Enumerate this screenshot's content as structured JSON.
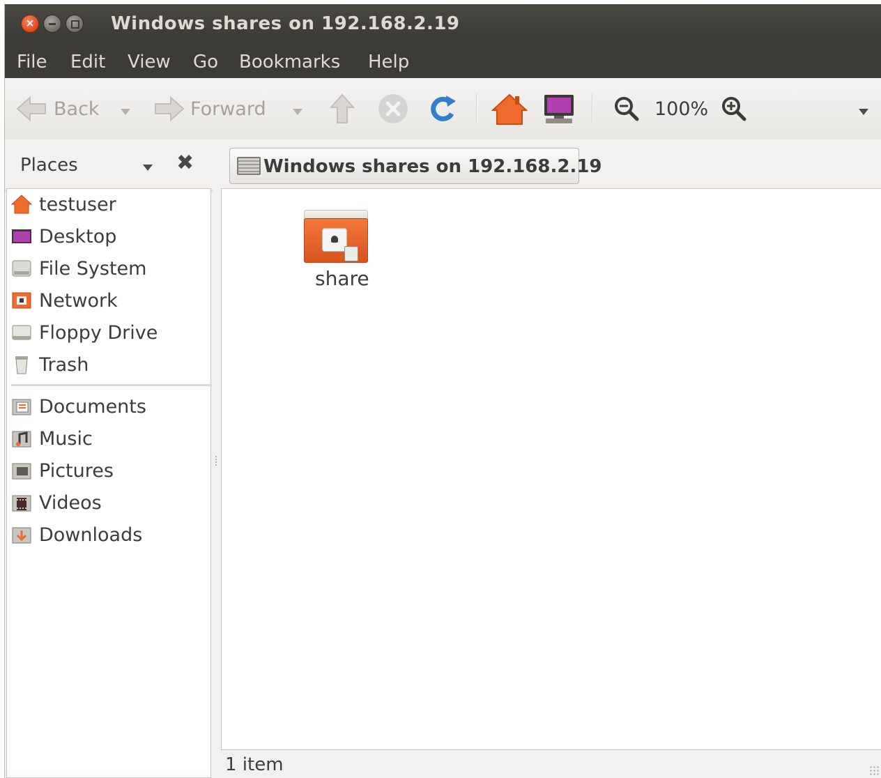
{
  "window": {
    "title": "Windows shares on 192.168.2.19"
  },
  "menubar": {
    "items": [
      "File",
      "Edit",
      "View",
      "Go",
      "Bookmarks",
      "Help"
    ]
  },
  "toolbar": {
    "back_label": "Back",
    "forward_label": "Forward",
    "zoom_level": "100%"
  },
  "places": {
    "header_label": "Places",
    "items": [
      {
        "label": "testuser",
        "icon": "home-icon"
      },
      {
        "label": "Desktop",
        "icon": "desktop-icon"
      },
      {
        "label": "File System",
        "icon": "harddisk-icon"
      },
      {
        "label": "Network",
        "icon": "network-icon"
      },
      {
        "label": "Floppy Drive",
        "icon": "floppy-icon"
      },
      {
        "label": "Trash",
        "icon": "trash-icon"
      }
    ],
    "bookmarks": [
      {
        "label": "Documents",
        "icon": "documents-folder-icon"
      },
      {
        "label": "Music",
        "icon": "music-folder-icon"
      },
      {
        "label": "Pictures",
        "icon": "pictures-folder-icon"
      },
      {
        "label": "Videos",
        "icon": "videos-folder-icon"
      },
      {
        "label": "Downloads",
        "icon": "downloads-folder-icon"
      }
    ]
  },
  "location": {
    "path_label": "Windows shares on 192.168.2.19"
  },
  "content": {
    "files": [
      {
        "name": "share",
        "icon": "shared-folder-icon"
      }
    ]
  },
  "statusbar": {
    "text": "1 item"
  },
  "colors": {
    "titlebar": "#3c3b37",
    "accent_orange": "#e9541e",
    "window_bg": "#f2f1f0"
  }
}
